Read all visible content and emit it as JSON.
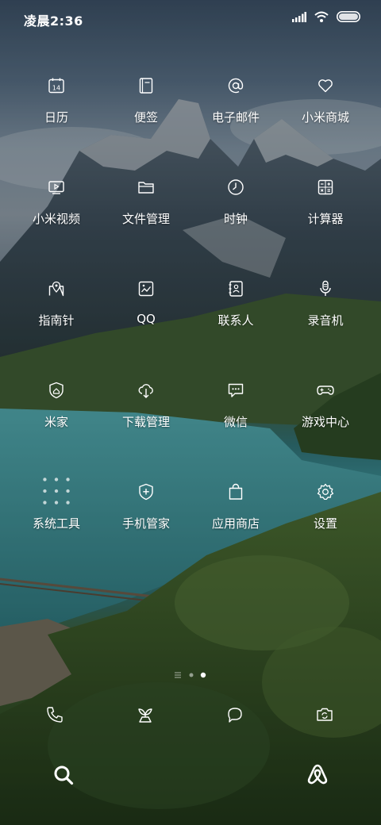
{
  "status_bar": {
    "time": "凌晨2:36",
    "icons": [
      "signal-icon",
      "wifi-icon",
      "battery-icon"
    ]
  },
  "apps": [
    {
      "label": "日历",
      "icon": "calendar-icon",
      "badge_text": "14"
    },
    {
      "label": "便签",
      "icon": "notes-icon"
    },
    {
      "label": "电子邮件",
      "icon": "email-icon"
    },
    {
      "label": "小米商城",
      "icon": "heart-icon"
    },
    {
      "label": "小米视频",
      "icon": "video-icon"
    },
    {
      "label": "文件管理",
      "icon": "folder-icon"
    },
    {
      "label": "时钟",
      "icon": "clock-icon"
    },
    {
      "label": "计算器",
      "icon": "calculator-icon"
    },
    {
      "label": "指南针",
      "icon": "map-pin-icon"
    },
    {
      "label": "QQ",
      "icon": "qq-icon"
    },
    {
      "label": "联系人",
      "icon": "contacts-icon"
    },
    {
      "label": "录音机",
      "icon": "microphone-icon"
    },
    {
      "label": "米家",
      "icon": "shield-home-icon"
    },
    {
      "label": "下载管理",
      "icon": "cloud-download-icon"
    },
    {
      "label": "微信",
      "icon": "chat-bubble-icon"
    },
    {
      "label": "游戏中心",
      "icon": "gamepad-icon"
    },
    {
      "label": "系统工具",
      "icon": "folder-grid-icon"
    },
    {
      "label": "手机管家",
      "icon": "shield-plus-icon"
    },
    {
      "label": "应用商店",
      "icon": "shopping-bag-icon"
    },
    {
      "label": "设置",
      "icon": "gear-icon"
    }
  ],
  "dock": [
    "phone-icon",
    "plant-icon",
    "message-icon",
    "camera-icon"
  ],
  "pager": {
    "pages": 2,
    "current": 2
  },
  "bottom_bar": [
    "search-icon",
    "airbnb-icon"
  ]
}
